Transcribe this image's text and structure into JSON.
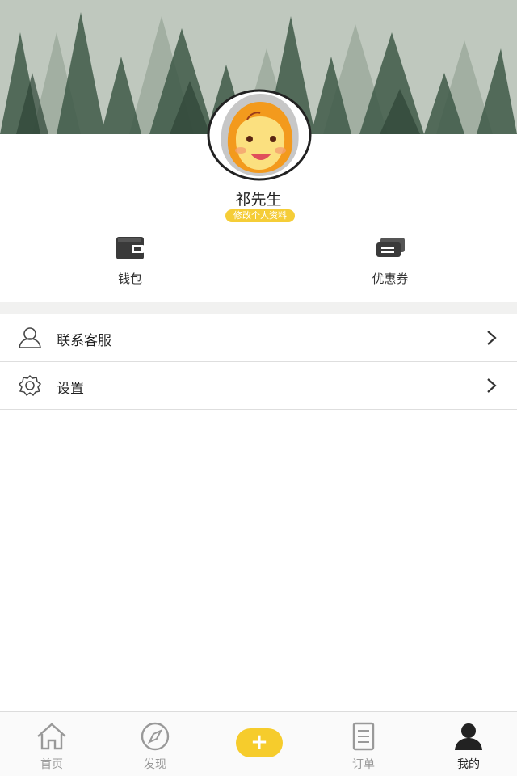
{
  "profile": {
    "name": "祁先生",
    "edit_label": "修改个人资料"
  },
  "quick_actions": [
    {
      "label": "钱包",
      "icon": "wallet-icon"
    },
    {
      "label": "优惠券",
      "icon": "coupon-icon"
    }
  ],
  "menu": [
    {
      "label": "联系客服",
      "icon": "customer-service-icon"
    },
    {
      "label": "设置",
      "icon": "settings-gear-icon"
    }
  ],
  "tabbar": [
    {
      "label": "首页",
      "icon": "home-icon",
      "active": false
    },
    {
      "label": "发现",
      "icon": "compass-icon",
      "active": false
    },
    {
      "label": "+",
      "icon": "plus-icon",
      "active": false
    },
    {
      "label": "订单",
      "icon": "order-list-icon",
      "active": false
    },
    {
      "label": "我的",
      "icon": "user-icon",
      "active": true
    }
  ],
  "colors": {
    "accent": "#f6cc2c",
    "active_tab": "#222222",
    "inactive_tab": "#999999"
  }
}
